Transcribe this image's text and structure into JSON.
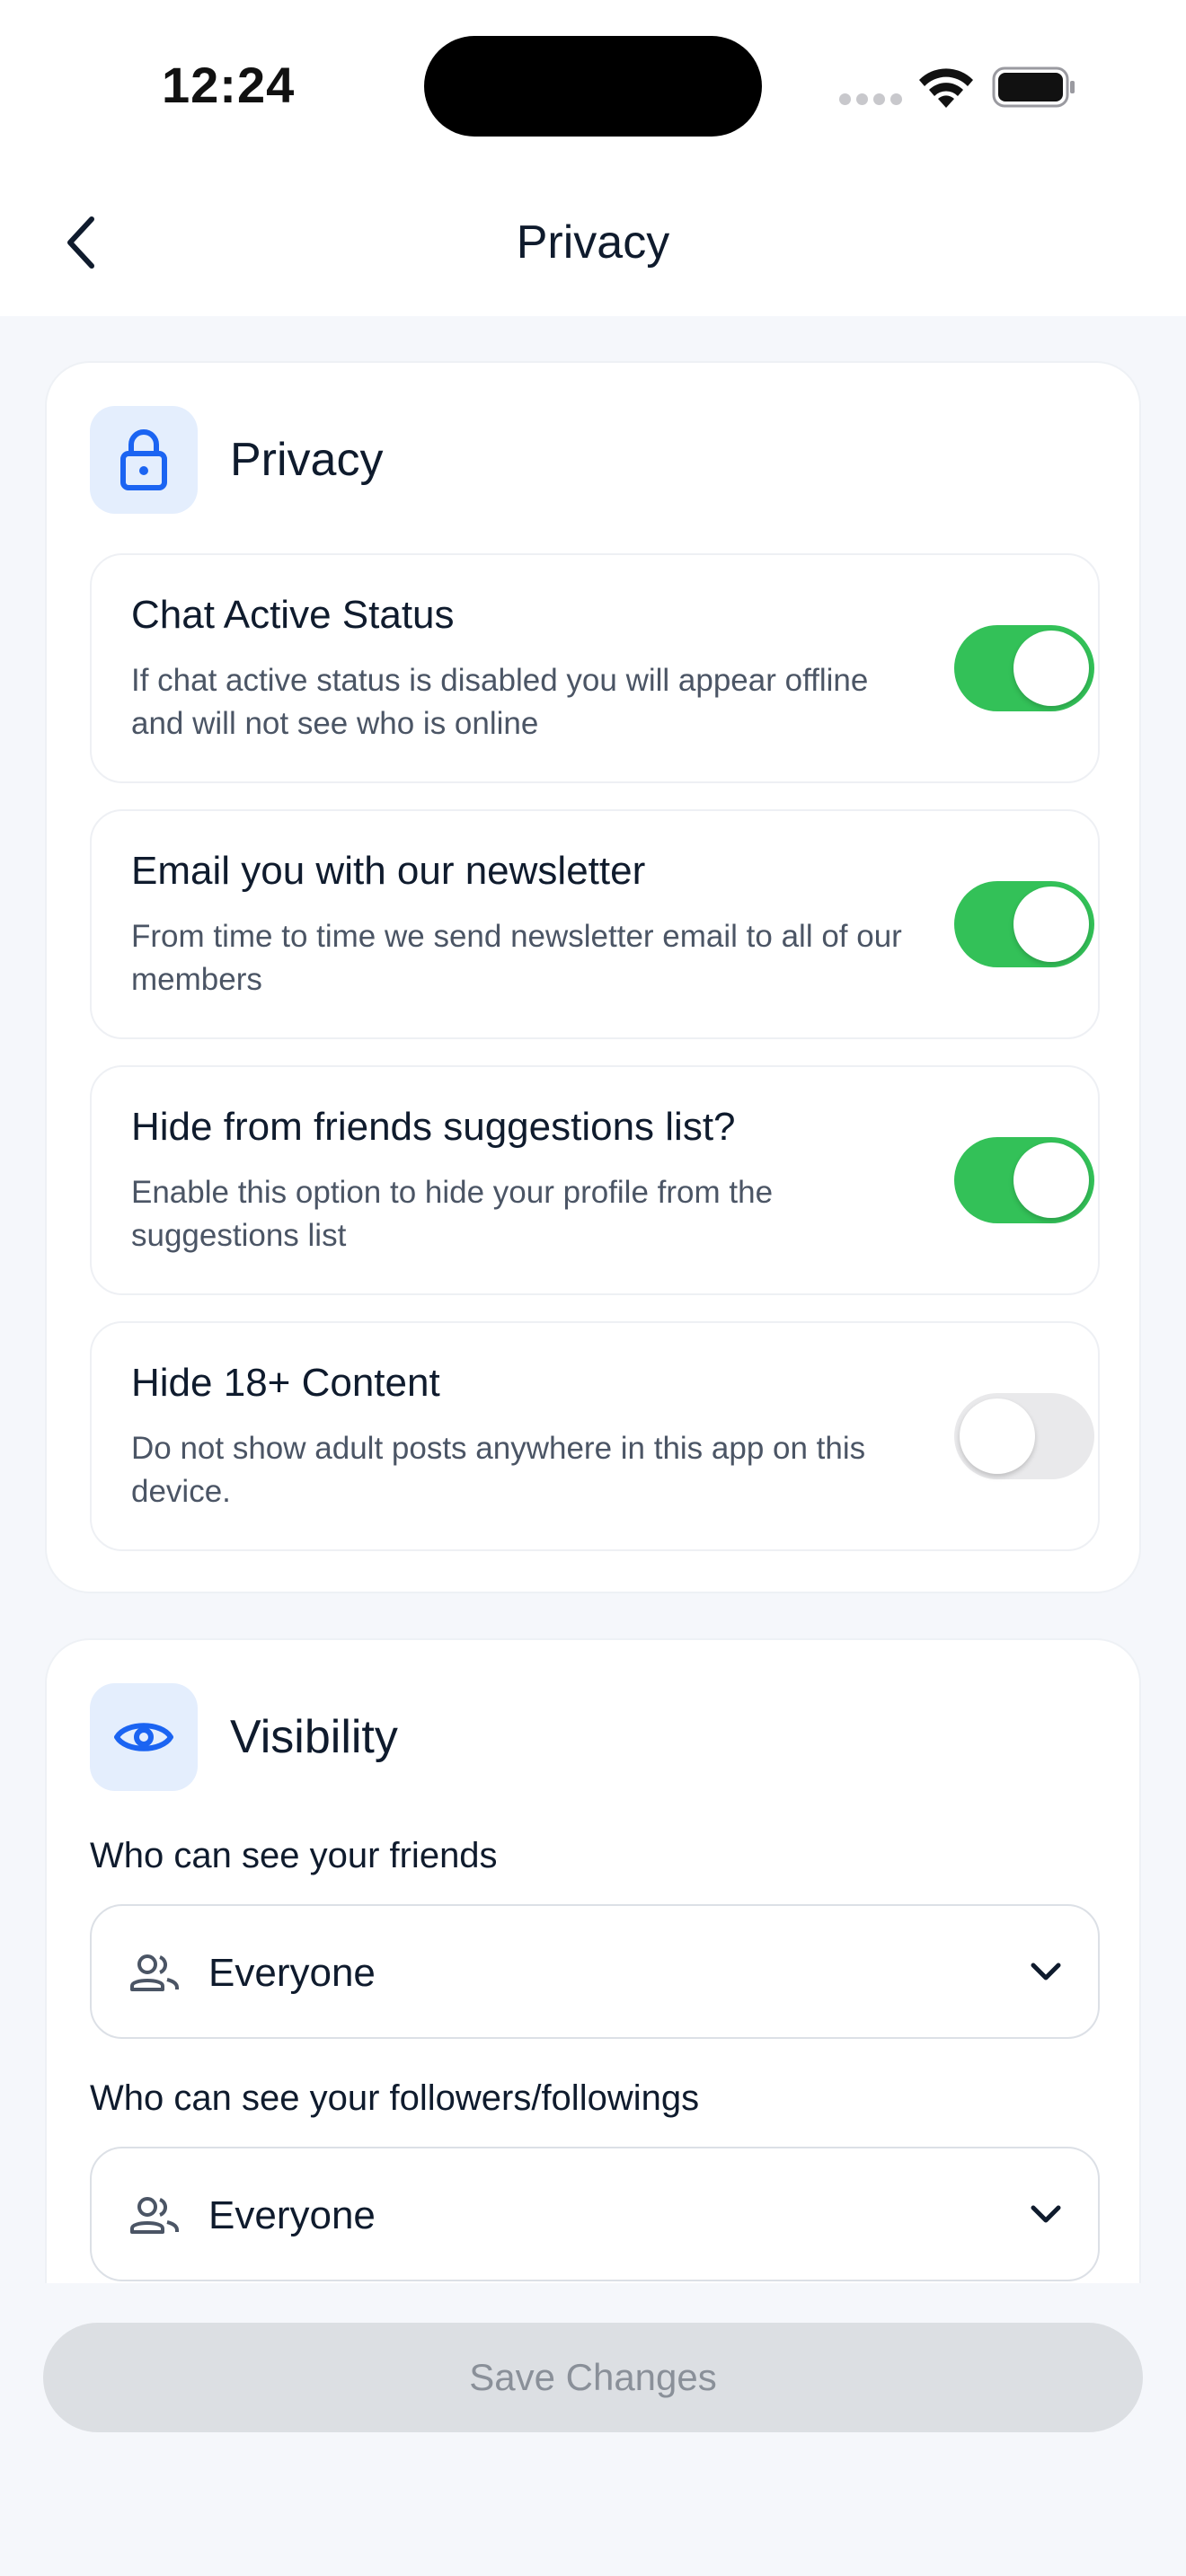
{
  "status_bar": {
    "time": "12:24"
  },
  "nav": {
    "title": "Privacy"
  },
  "privacy": {
    "title": "Privacy",
    "settings": [
      {
        "title": "Chat Active Status",
        "description": "If chat active status is disabled you will appear offline and will not see who is online",
        "enabled": true
      },
      {
        "title": "Email you with our newsletter",
        "description": "From time to time we send newsletter email to all of our members",
        "enabled": true
      },
      {
        "title": "Hide from friends suggestions list?",
        "description": "Enable this option to hide your profile from the suggestions list",
        "enabled": true
      },
      {
        "title": "Hide 18+ Content",
        "description": "Do not show adult posts anywhere in this app on this device.",
        "enabled": false
      }
    ]
  },
  "visibility": {
    "title": "Visibility",
    "friends": {
      "label": "Who can see your friends",
      "value": "Everyone"
    },
    "followers": {
      "label": "Who can see your followers/followings",
      "value": "Everyone"
    }
  },
  "save_label": "Save Changes",
  "colors": {
    "accent": "#1B64F2",
    "toggle_on": "#33C158",
    "toggle_off": "#E9E9EB",
    "icon_tile": "#E4EEFD"
  }
}
